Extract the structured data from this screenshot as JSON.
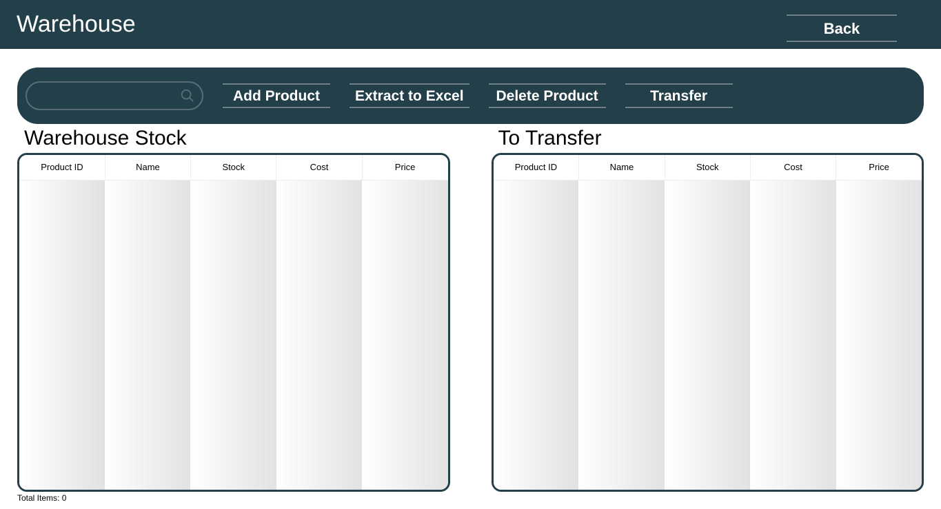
{
  "header": {
    "title": "Warehouse",
    "back_label": "Back"
  },
  "toolbar": {
    "search_value": "",
    "search_placeholder": "",
    "buttons": {
      "add_product": "Add Product",
      "extract_excel": "Extract to Excel",
      "delete_product": "Delete Product",
      "transfer": "Transfer"
    }
  },
  "panels": {
    "stock": {
      "title": "Warehouse Stock",
      "columns": [
        "Product ID",
        "Name",
        "Stock",
        "Cost",
        "Price"
      ],
      "rows": []
    },
    "transfer": {
      "title": "To Transfer",
      "columns": [
        "Product ID",
        "Name",
        "Stock",
        "Cost",
        "Price"
      ],
      "rows": []
    }
  },
  "footer": {
    "total_items_label": "Total Items: 0"
  },
  "icons": {
    "search": "search-icon"
  },
  "colors": {
    "primary_bg": "#23404a",
    "accent_border": "#6f8087"
  }
}
